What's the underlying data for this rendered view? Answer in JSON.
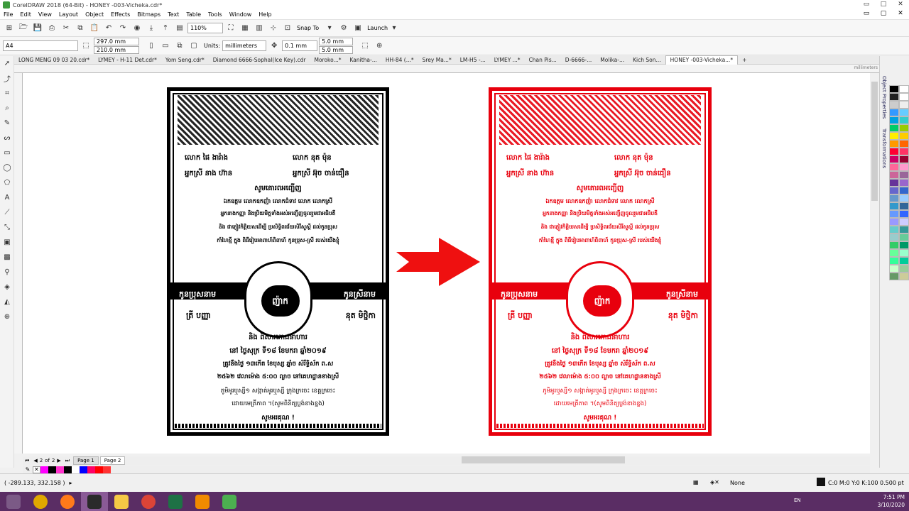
{
  "window": {
    "title": "CorelDRAW 2018 (64-Bit) - HONEY -003-Vicheka.cdr*",
    "controls": [
      "▭",
      "□",
      "✕"
    ]
  },
  "menu": [
    "File",
    "Edit",
    "View",
    "Layout",
    "Object",
    "Effects",
    "Bitmaps",
    "Text",
    "Table",
    "Tools",
    "Window",
    "Help"
  ],
  "menu_controls": [
    "▭",
    "▢",
    "✕"
  ],
  "standard_bar": {
    "zoom": "110%",
    "snap": "Snap To",
    "launch": "Launch"
  },
  "property_bar": {
    "page_size": "A4",
    "width": "297.0 mm",
    "height": "210.0 mm",
    "units_label": "Units:",
    "units": "millimeters",
    "nudge": "0.1 mm",
    "dup_x": "5.0 mm",
    "dup_y": "5.0 mm"
  },
  "doc_tabs": [
    {
      "label": "LONG MENG 09 03 20.cdr*",
      "active": false
    },
    {
      "label": "LYMEY - H-11 Det.cdr*",
      "active": false
    },
    {
      "label": "Yom Seng.cdr*",
      "active": false
    },
    {
      "label": "Diamond 6666-Sophal(Ice Key).cdr",
      "active": false
    },
    {
      "label": "Moroko...*",
      "active": false
    },
    {
      "label": "Kanitha-...",
      "active": false
    },
    {
      "label": "HH-84 (...*",
      "active": false
    },
    {
      "label": "Srey Ma...*",
      "active": false
    },
    {
      "label": "LM-H5 -...",
      "active": false
    },
    {
      "label": "LYMEY ...*",
      "active": false
    },
    {
      "label": "Chan Pis...",
      "active": false
    },
    {
      "label": "D-6666-...",
      "active": false
    },
    {
      "label": "Molika-...",
      "active": false
    },
    {
      "label": "Kich Son...",
      "active": false
    },
    {
      "label": "HONEY -003-Vicheka...*",
      "active": true
    }
  ],
  "ruler": {
    "units": "millimeters"
  },
  "dockers": [
    "Object Properties",
    "Transformations"
  ],
  "page_nav": {
    "current": "2",
    "of": "of",
    "total": "2",
    "pages": [
      "Page 1",
      "Page 2"
    ]
  },
  "status": {
    "coords": "( -289.133, 332.158 )",
    "fill": "None",
    "outline": "C:0 M:0 Y:0 K:100  0.500 pt"
  },
  "tray": {
    "lang": "EN",
    "time": "7:51 PM",
    "date": "3/10/2020"
  },
  "card_text": {
    "l1a": "លោក  ផៃ ងារ៉ាង",
    "l1b": "លោក  នុត ម៉ុន",
    "l2a": "អ្នកស្រី  នាង ហ៊ាន",
    "l2b": "អ្នកស្រី  អ៊ុច ចាន់ធឿន",
    "head": "សូមគោរពអញ្ជើញ",
    "p1": "ឯកឧត្តម  លោកឧកញ៉ា  លោកជំទាវ  លោក  លោកស្រី",
    "p2": "អ្នកនាងកញ្ញា  និងប្រិយមិត្តទាំងអស់អញ្ជើញចូលរួមជាអធិបតី",
    "p3": "និង  ជាភ្ញៀវកិត្តិយសដើម្បី  ប្រសិទ្ធិពរជ័យសិរីសួស្តី  ដល់កូនប្រុស",
    "p4": "កាំហៃខ្មី ក្នុង ពិធីរៀបអាពាហ៍ពិពាហ៍ កូនប្រុស-ស្រី របស់យើងខ្ញុំ",
    "groom_label": "កូនប្រុសនាម",
    "bride_label": "កូនស្រីនាម",
    "medal": "ញ៉ាក",
    "groom": "ត្រី បញ្ញា",
    "bride": "នុត មិថ្ជិកា",
    "and": "និង ពិសារភោជនាហារ",
    "d1": "នៅ ថ្ងៃសុក្រ  ទី១៨  ខែមករា  ឆ្នាំ២០១៩",
    "d2": "ត្រូវនឹងថ្ងៃ ១៣កើត ខែបុស្ស ឆ្នាំច សំរឹទ្ធិស័ក ព.ស",
    "d3": "២៥៦២ វេលាម៉ោង ៥:០០ ល្ងាច នៅគេហដ្ឋានខាងស្រី",
    "d4": "ភូមិអូរឬស្សី១ សង្កាត់អូរឬស្សី ក្រុងក្រចេះ ខេត្តក្រចេះ",
    "d5": "ដោយមេត្រីភាព ។(សូមពិនិត្យប្លង់ខាងខ្នង)",
    "thanks": "សូមអរគុណ !"
  },
  "colors": {
    "black": "#000000",
    "red": "#e8000d",
    "arrow": "#ef1010"
  },
  "palette": [
    "#000000",
    "#ffffff",
    "#222222",
    "#ffffff",
    "#cccccc",
    "#eeeeee",
    "#3399ff",
    "#66ccff",
    "#00a0e0",
    "#33cccc",
    "#00cc66",
    "#99cc00",
    "#ffee00",
    "#ffcc00",
    "#ff9900",
    "#ff6600",
    "#ff0033",
    "#ff3366",
    "#cc0066",
    "#990033",
    "#ff6699",
    "#ff99cc",
    "#cc6699",
    "#996699",
    "#663399",
    "#9966cc",
    "#6666cc",
    "#3366cc",
    "#6699cc",
    "#99ccff",
    "#3399cc",
    "#336699",
    "#6699ff",
    "#3366ff",
    "#9999ff",
    "#ccccff",
    "#66cccc",
    "#339999",
    "#99cccc",
    "#66cc99",
    "#33cc66",
    "#009966",
    "#66ff99",
    "#99ffcc",
    "#33ff99",
    "#00cc99",
    "#ccffcc",
    "#99cc99",
    "#669966",
    "#cccc99"
  ],
  "colorbar": [
    "#ff00ff",
    "#000000",
    "#ff33cc",
    "#000000",
    "#ffffff",
    "#0000ff",
    "#ff0066",
    "#ff0000",
    "#ff3333"
  ]
}
